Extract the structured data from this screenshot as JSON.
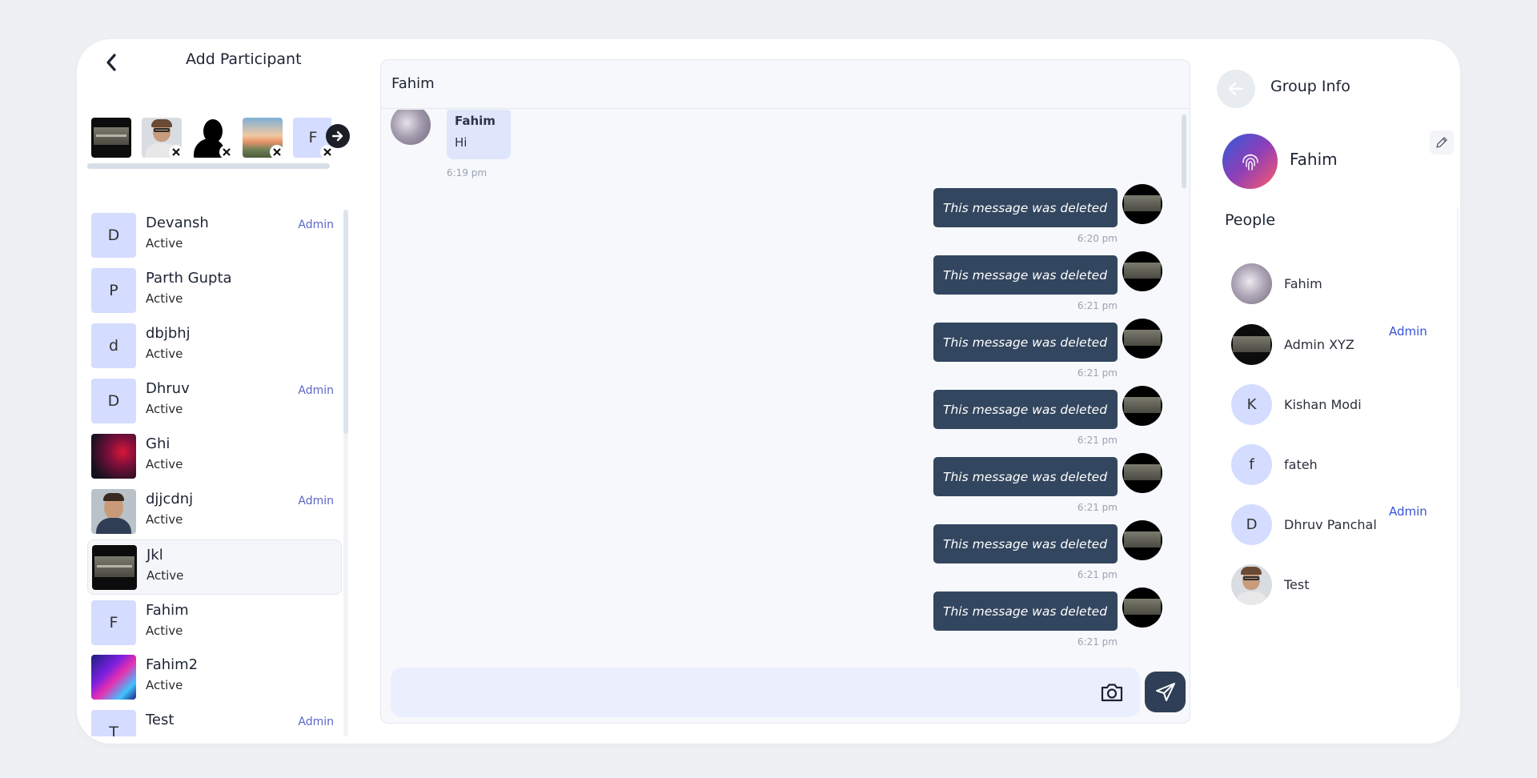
{
  "left_panel": {
    "title": "Add Participant",
    "selected_letter": "F",
    "participants": [
      {
        "name": "Devansh",
        "status": "Active",
        "initial": "D",
        "avatar": "letter",
        "admin": "Admin"
      },
      {
        "name": "Parth Gupta",
        "status": "Active",
        "initial": "P",
        "avatar": "letter",
        "admin": ""
      },
      {
        "name": "dbjbhj",
        "status": "Active",
        "initial": "d",
        "avatar": "letter",
        "admin": ""
      },
      {
        "name": "Dhruv",
        "status": "Active",
        "initial": "D",
        "avatar": "letter",
        "admin": "Admin"
      },
      {
        "name": "Ghi",
        "status": "Active",
        "initial": "",
        "avatar": "photo-red",
        "admin": ""
      },
      {
        "name": "djjcdnj",
        "status": "Active",
        "initial": "",
        "avatar": "photo-man",
        "admin": "Admin"
      },
      {
        "name": "Jkl",
        "status": "Active",
        "initial": "",
        "avatar": "photo-dark",
        "admin": ""
      },
      {
        "name": "Fahim",
        "status": "Active",
        "initial": "F",
        "avatar": "letter",
        "admin": ""
      },
      {
        "name": "Fahim2",
        "status": "Active",
        "initial": "",
        "avatar": "photo-geo",
        "admin": ""
      },
      {
        "name": "Test",
        "status": "",
        "initial": "T",
        "avatar": "letter",
        "admin": "Admin"
      }
    ]
  },
  "chat": {
    "title": "Fahim",
    "incoming": {
      "sender": "Fahim",
      "text": "Hi",
      "time": "6:19 pm"
    },
    "outgoing": [
      {
        "text": "This message was deleted",
        "time": "6:20 pm"
      },
      {
        "text": "This message was deleted",
        "time": "6:21 pm"
      },
      {
        "text": "This message was deleted",
        "time": "6:21 pm"
      },
      {
        "text": "This message was deleted",
        "time": "6:21 pm"
      },
      {
        "text": "This message was deleted",
        "time": "6:21 pm"
      },
      {
        "text": "This message was deleted",
        "time": "6:21 pm"
      },
      {
        "text": "This message was deleted",
        "time": "6:21 pm"
      }
    ]
  },
  "group_info": {
    "title": "Group Info",
    "group_name": "Fahim",
    "people_heading": "People",
    "members": [
      {
        "name": "Fahim",
        "initial": "",
        "avatar": "photo-cat",
        "admin": ""
      },
      {
        "name": "Admin XYZ",
        "initial": "",
        "avatar": "photo-dark",
        "admin": "Admin"
      },
      {
        "name": "Kishan Modi",
        "initial": "K",
        "avatar": "letter",
        "admin": ""
      },
      {
        "name": "fateh",
        "initial": "f",
        "avatar": "letter",
        "admin": ""
      },
      {
        "name": "Dhruv Panchal",
        "initial": "D",
        "avatar": "letter",
        "admin": "Admin"
      },
      {
        "name": "Test",
        "initial": "",
        "avatar": "photo-man",
        "admin": ""
      }
    ]
  },
  "colors": {
    "accent_admin": "#5b67c7",
    "bubble_dark": "#33465f",
    "letter_avatar_bg": "#d4dcff"
  }
}
